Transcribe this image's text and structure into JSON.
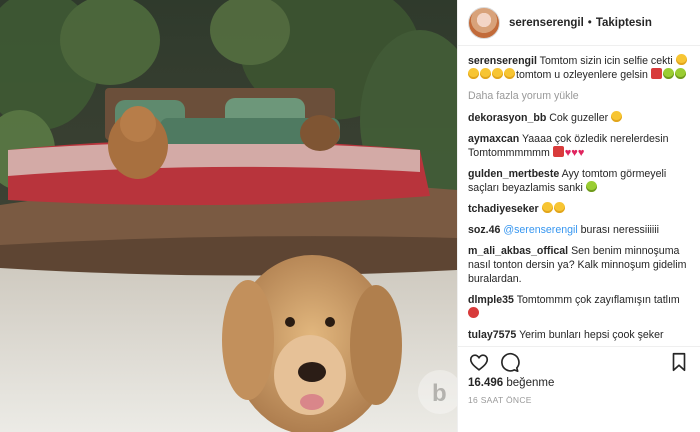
{
  "header": {
    "username": "serenserengil",
    "separator": "•",
    "follow_status": "Takiptesin"
  },
  "caption": {
    "username": "serenserengil",
    "text_before": "Tomtom sizin icin selfie cekti",
    "text_mid": "tomtom u ozleyenlere gelsin"
  },
  "load_more": "Daha fazla yorum yükle",
  "comments": [
    {
      "user": "dekorasyon_bb",
      "text": "Cok guzeller"
    },
    {
      "user": "aymaxcan",
      "text": "Yaaaa çok özledik nerelerdesin Tomtommmmmm"
    },
    {
      "user": "gulden_mertbeste",
      "text": "Ayy tomtom görmeyeli saçları beyazlamis sanki"
    },
    {
      "user": "tchadiyeseker",
      "text": ""
    },
    {
      "user": "soz.46",
      "mention": "@serenserengil",
      "text": "burası neressiiiiii"
    },
    {
      "user": "m_ali_akbas_offical",
      "text": "Sen benim minnoşuma nasıl tonton dersin ya? Kalk minnoşum gidelim buralardan."
    },
    {
      "user": "dlmple35",
      "text": "Tomtommm çok zayıflamışın tatlım"
    },
    {
      "user": "tulay7575",
      "text": "Yerim bunları hepsi çook şeker"
    }
  ],
  "likes": {
    "count": "16.496",
    "label": "beğenme"
  },
  "timestamp": "16 SAAT ÖNCE",
  "icons": [
    "heart-icon",
    "comment-icon",
    "bookmark-icon"
  ],
  "colors": {
    "link": "#3897f0",
    "text": "#262626",
    "muted": "#999999",
    "border": "#efefef"
  }
}
